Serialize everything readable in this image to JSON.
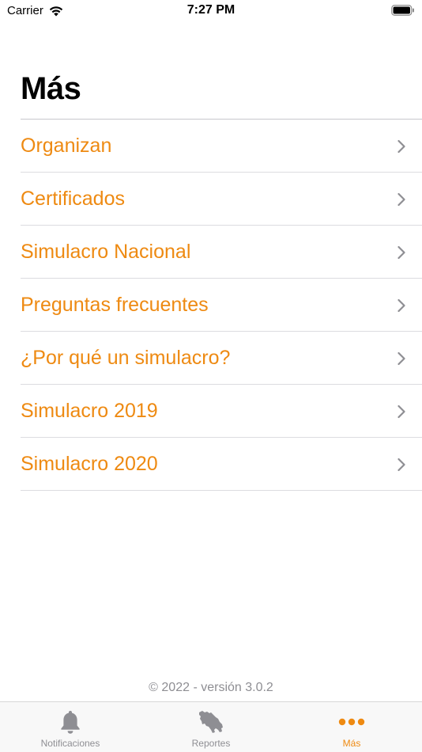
{
  "status_bar": {
    "carrier": "Carrier",
    "time": "7:27 PM"
  },
  "page": {
    "title": "Más"
  },
  "menu": {
    "items": [
      {
        "label": "Organizan"
      },
      {
        "label": "Certificados"
      },
      {
        "label": "Simulacro Nacional"
      },
      {
        "label": "Preguntas frecuentes"
      },
      {
        "label": "¿Por qué un simulacro?"
      },
      {
        "label": "Simulacro 2019"
      },
      {
        "label": "Simulacro 2020"
      }
    ]
  },
  "footer": {
    "version": "© 2022 - versión 3.0.2"
  },
  "tab_bar": {
    "tabs": [
      {
        "label": "Notificaciones",
        "icon": "bell-icon",
        "active": false
      },
      {
        "label": "Reportes",
        "icon": "costa-rica-map-icon",
        "active": false
      },
      {
        "label": "Más",
        "icon": "more-dots-icon",
        "active": true
      }
    ]
  },
  "colors": {
    "accent": "#ee8a12",
    "inactive": "#8e8e93",
    "separator": "#dcdce0"
  }
}
